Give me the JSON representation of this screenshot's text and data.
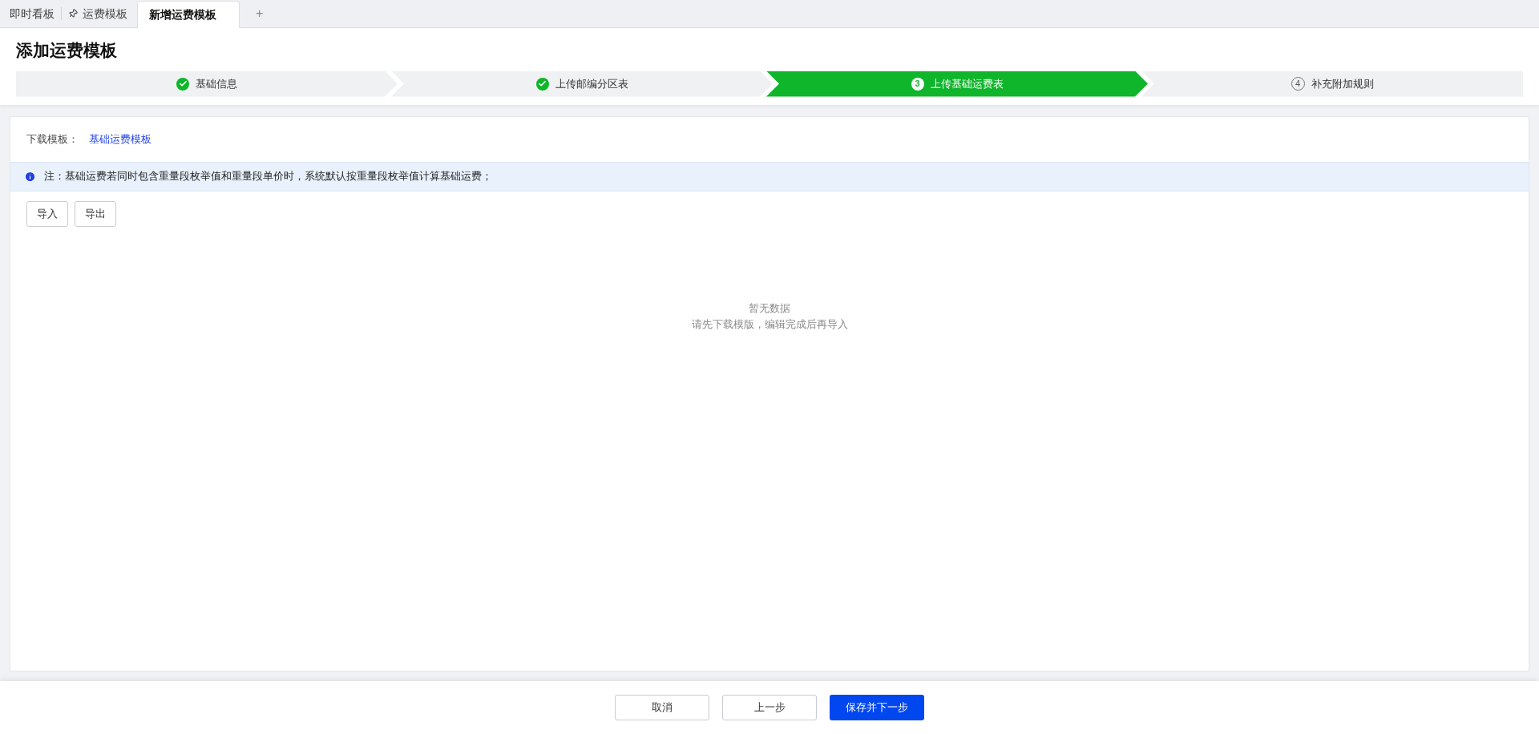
{
  "tabs": [
    {
      "label": "即时看板",
      "pinned": false,
      "selected": false
    },
    {
      "label": "运费模板",
      "pinned": true,
      "selected": false
    },
    {
      "label": "新增运费模板",
      "pinned": false,
      "selected": true
    }
  ],
  "add_tab": "+",
  "page_title": "添加运费模板",
  "steps": [
    {
      "label": "基础信息",
      "completed": true,
      "selected": false
    },
    {
      "label": "上传邮编分区表",
      "completed": true,
      "selected": false
    },
    {
      "label": "上传基础运费表",
      "completed": false,
      "selected": true,
      "number": "3"
    },
    {
      "label": "补充附加规则",
      "completed": false,
      "selected": false,
      "number": "4"
    }
  ],
  "download": {
    "label": "下载模板：",
    "link": "基础运费模板"
  },
  "notice": "注：基础运费若同时包含重量段枚举值和重量段单价时，系统默认按重量段枚举值计算基础运费；",
  "actions": [
    "导入",
    "导出"
  ],
  "empty": {
    "title": "暂无数据",
    "hint": "请先下载模版，编辑完成后再导入"
  },
  "footer": [
    {
      "label": "取消",
      "kind": "default"
    },
    {
      "label": "上一步",
      "kind": "default"
    },
    {
      "label": "保存并下一步",
      "kind": "primary"
    }
  ]
}
